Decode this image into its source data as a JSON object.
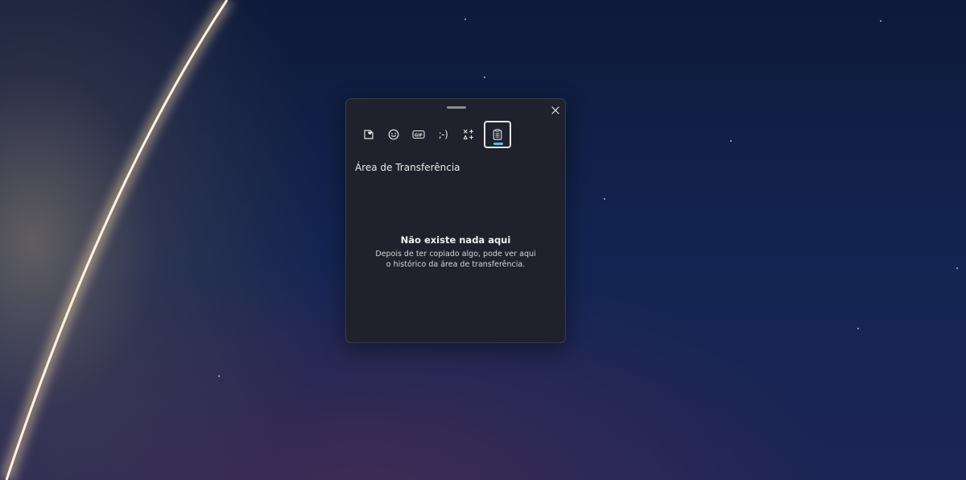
{
  "panel": {
    "close_icon": "close-icon",
    "tabs": [
      {
        "name": "stickers",
        "icon": "sticker-heart-icon",
        "active": false
      },
      {
        "name": "emoji",
        "icon": "smiley-icon",
        "active": false
      },
      {
        "name": "gif",
        "icon": "gif-icon",
        "label": "GIF",
        "active": false
      },
      {
        "name": "kaomoji",
        "icon": "kaomoji-icon",
        "label": ";-)",
        "active": false
      },
      {
        "name": "symbols",
        "icon": "symbols-icon",
        "active": false
      },
      {
        "name": "clipboard",
        "icon": "clipboard-icon",
        "active": true
      }
    ],
    "section_title": "Área de Transferência",
    "empty_title": "Não existe nada aqui",
    "empty_description": "Depois de ter copiado algo, pode ver aqui o histórico da área de transferência."
  },
  "colors": {
    "panel_bg": "#1f222c",
    "accent": "#4cc2ff"
  }
}
